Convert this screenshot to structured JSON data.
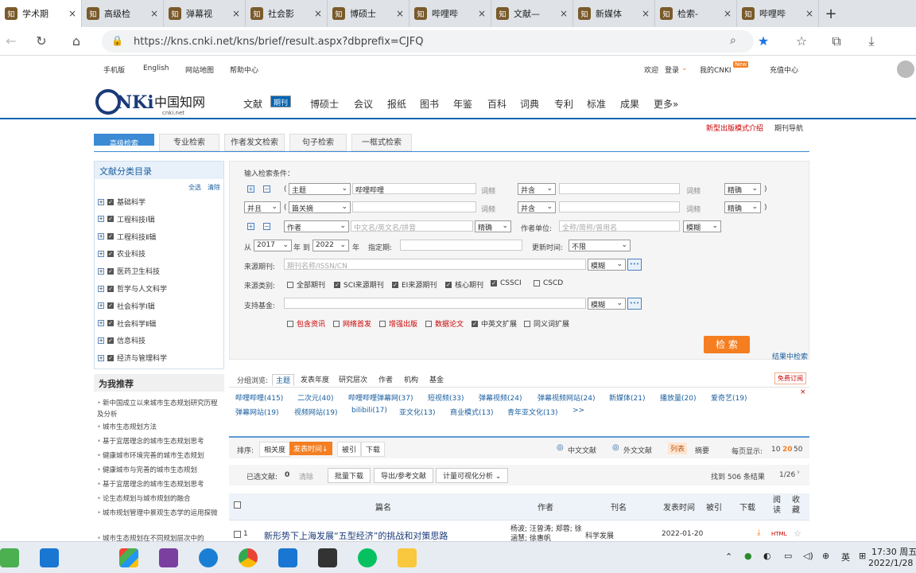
{
  "browser": {
    "tabs": [
      {
        "title": "学术期",
        "active": true
      },
      {
        "title": "高级检",
        "active": false
      },
      {
        "title": "弹幕视",
        "active": false
      },
      {
        "title": "社会影",
        "active": false
      },
      {
        "title": "博硕士",
        "active": false
      },
      {
        "title": "哔哩哔",
        "active": false
      },
      {
        "title": "文献—",
        "active": false
      },
      {
        "title": "新媒体",
        "active": false
      },
      {
        "title": "检索-",
        "active": false
      },
      {
        "title": "哔哩哔",
        "active": false
      }
    ],
    "tab_icon_text": "知",
    "url": "https://kns.cnki.net/kns/brief/result.aspx?dbprefix=CJFQ"
  },
  "site": {
    "top_links": [
      "手机版",
      "English",
      "网站地图",
      "帮助中心"
    ],
    "welcome": "欢迎",
    "login": "登录",
    "my_cnki": "我的CNKI",
    "new_badge": "New",
    "recharge": "充值中心",
    "logo_text": "CNKi中国知网",
    "logo_sub": "cnki.net",
    "nav": [
      "文献",
      "期刊",
      "博硕士",
      "会议",
      "报纸",
      "图书",
      "年鉴",
      "百科",
      "词典",
      "专利",
      "标准",
      "成果",
      "更多»"
    ],
    "nav_selected": 1,
    "new_mode_link": "新型出版模式介绍",
    "journal_nav": "期刊导航"
  },
  "search_tabs": [
    "高级检索",
    "专业检索",
    "作者发文检索",
    "句子检索",
    "一框式检索"
  ],
  "left": {
    "title": "文献分类目录",
    "select_all": "全选",
    "clear": "清除",
    "categories": [
      "基础科学",
      "工程科技Ⅰ辑",
      "工程科技Ⅱ辑",
      "农业科技",
      "医药卫生科技",
      "哲学与人文科学",
      "社会科学Ⅰ辑",
      "社会科学Ⅱ辑",
      "信息科技",
      "经济与管理科学"
    ],
    "rec_title": "为我推荐",
    "rec_items": [
      "新中国成立以来城市生态规划研究历程及分析",
      "城市生态规划方法",
      "基于宜居理念的城市生态规划思考",
      "健康城市环境完善的城市生态规划",
      "健康城市与完善的城市生态规划",
      "基于宜居理念的城市生态规划思考",
      "论生态规划与城市规划的融合",
      "城市规划管理中景观生态学的运用探微",
      "城市生态规划在不同规划层次中的"
    ]
  },
  "form": {
    "title": "输入检索条件：",
    "paren_open": "(",
    "paren_close": ")",
    "row1": {
      "field": "主题",
      "value": "哔哩哔哩",
      "freq": "词频",
      "logic": "并含",
      "freq2": "词频",
      "match": "精确"
    },
    "row2": {
      "op": "并且",
      "field": "篇关摘",
      "freq": "词频",
      "logic": "并含",
      "freq2": "词频",
      "match": "精确"
    },
    "row3": {
      "field": "作者",
      "author_ph": "中文名/英文名/拼音",
      "match": "精确",
      "unit_label": "作者单位:",
      "unit_ph": "全称/简称/曾用名",
      "unit_match": "模糊"
    },
    "date": {
      "from": "从",
      "from_year": "2017",
      "to": "年 到",
      "to_year": "2022",
      "year": "年",
      "spec": "指定期:",
      "update": "更新时间:",
      "update_value": "不限"
    },
    "source_label": "来源期刊:",
    "source_ph": "期刊名称/ISSN/CN",
    "source_match": "模糊",
    "type_label": "来源类别:",
    "types": [
      {
        "label": "全部期刊",
        "checked": false
      },
      {
        "label": "SCI来源期刊",
        "checked": true
      },
      {
        "label": "EI来源期刊",
        "checked": true
      },
      {
        "label": "核心期刊",
        "checked": true
      },
      {
        "label": "CSSCI",
        "checked": true
      },
      {
        "label": "CSCD",
        "checked": false
      }
    ],
    "fund_label": "支持基金:",
    "fund_match": "模糊",
    "more_btn": "•••",
    "options": [
      {
        "label": "包含资讯",
        "checked": false,
        "red": true
      },
      {
        "label": "网络首发",
        "checked": false,
        "red": true
      },
      {
        "label": "增强出版",
        "checked": false,
        "red": true
      },
      {
        "label": "数据论文",
        "checked": false,
        "red": true
      },
      {
        "label": "中英文扩展",
        "checked": true,
        "red": false
      },
      {
        "label": "同义词扩展",
        "checked": false,
        "red": false
      }
    ],
    "search_btn": "检 索",
    "in_results": "结果中检索"
  },
  "group": {
    "label": "分组浏览:",
    "tabs": [
      "主题",
      "发表年度",
      "研究层次",
      "作者",
      "机构",
      "基金"
    ],
    "subscribe": "免费订阅",
    "items": [
      "哔哩哔哩(415)",
      "二次元(40)",
      "哔哩哔哩弹幕网(37)",
      "短视频(33)",
      "弹幕视频(24)",
      "弹幕视频网站(24)",
      "新媒体(21)",
      "播放量(20)",
      "爱奇艺(19)",
      "弹幕网站(19)",
      "视频网站(19)",
      "bilibili(17)",
      "亚文化(13)",
      "商业模式(13)",
      "青年亚文化(13)",
      ">>"
    ]
  },
  "results": {
    "sort_label": "排序:",
    "sort": [
      "相关度",
      "发表时间↓",
      "被引",
      "下载"
    ],
    "lang_cn": "中文文献",
    "lang_en": "外文文献",
    "view_list": "列表",
    "view_abs": "摘要",
    "per_page": "每页显示:",
    "per_page_opts": [
      "10",
      "20",
      "50"
    ],
    "selected": "已选文献:",
    "selected_count": "0",
    "clear": "清除",
    "batch_download": "批量下载",
    "export": "导出/参考文献",
    "viz": "计量可视化分析",
    "found": "找到 506 条结果",
    "page": "1/26",
    "columns": [
      "篇名",
      "作者",
      "刊名",
      "发表时间",
      "被引",
      "下载",
      "阅读",
      "收藏"
    ],
    "rows": [
      {
        "num": "1",
        "title": "新形势下上海发展“五型经济”的挑战和对策思路",
        "authors": "杨波; 汪曾涛; 郑蓉; 徐涵慧; 徐惠帆",
        "journal": "科学发展",
        "date": "2022-01-20",
        "html": "HTML"
      }
    ]
  },
  "taskbar": {
    "ime": "英",
    "time": "17:30 周五",
    "date": "2022/1/28"
  }
}
